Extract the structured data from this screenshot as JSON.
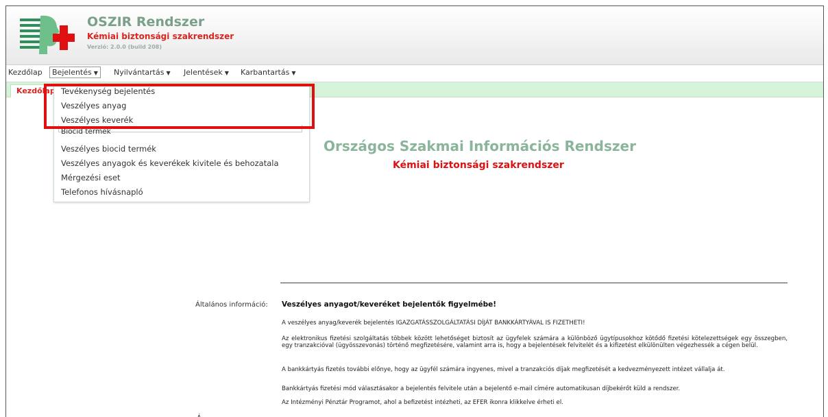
{
  "app": {
    "title": "OSZIR Rendszer",
    "subtitle": "Kémiai biztonsági szakrendszer",
    "version": "Verzió: 2.0.0 (build 208)"
  },
  "menu": {
    "items": [
      {
        "label": "Kezdőlap",
        "dropdown": false
      },
      {
        "label": "Bejelentés",
        "dropdown": true
      },
      {
        "label": "Nyilvántartás",
        "dropdown": true
      },
      {
        "label": "Jelentések",
        "dropdown": true
      },
      {
        "label": "Karbantartás",
        "dropdown": true
      }
    ],
    "caret": "▼"
  },
  "tabs": {
    "active_label": "Kezdőlap"
  },
  "dropdown": {
    "items": [
      "Tevékenység bejelentés",
      "Veszélyes anyag",
      "Veszélyes keverék",
      "Biocid termék",
      "Veszélyes biocid termék",
      "Veszélyes anyagok és keverékek kivitele és behozatala",
      "Mérgezési eset",
      "Telefonos hívásnapló"
    ]
  },
  "main": {
    "title": "Országos Szakmai Információs Rendszer",
    "subtitle": "Kémiai biztonsági szakrendszer"
  },
  "info": {
    "label": "Általános információ:",
    "heading": "Veszélyes anyagot/keveréket bejelentők figyelmébe!",
    "paragraphs": [
      "A veszélyes anyag/keverék bejelentés IGAZGATÁSSZOLGÁLTATÁSI DÍJÁT BANKKÁRTYÁVAL IS FIZETHETI!",
      "Az elektronikus fizetési szolgáltatás többek között lehetőséget biztosít az ügyfelek számára a különböző ügytípusokhoz kötődő fizetési kötelezettségek egy összegben, egy tranzakcióval (ügyösszevonás) történő megfizetésére, valamint arra is, hogy a bejelentések felvitelét és a kifizetést elkülönülten végezhessék a cégen belül.",
      "A bankkártyás fizetés további előnye, hogy az ügyfél számára ingyenes, mivel a tranzakciós díjak megfizetését a kedvezményezett intézet vállalja át.",
      "Bankkártyás fizetési mód választásakor a bejelentés felvitele után a bejelentő e-mail címére automatikusan díjbekérőt küld a rendszer.",
      "Az Intézményi Pénztár Programot, ahol a befizetést intézheti, az EFER ikonra klikkelve érheti el."
    ]
  },
  "colors": {
    "brand_green": "#8ab59a",
    "brand_red": "#d8261e",
    "tab_strip": "#d4f3d8",
    "highlight": "#e01010"
  }
}
